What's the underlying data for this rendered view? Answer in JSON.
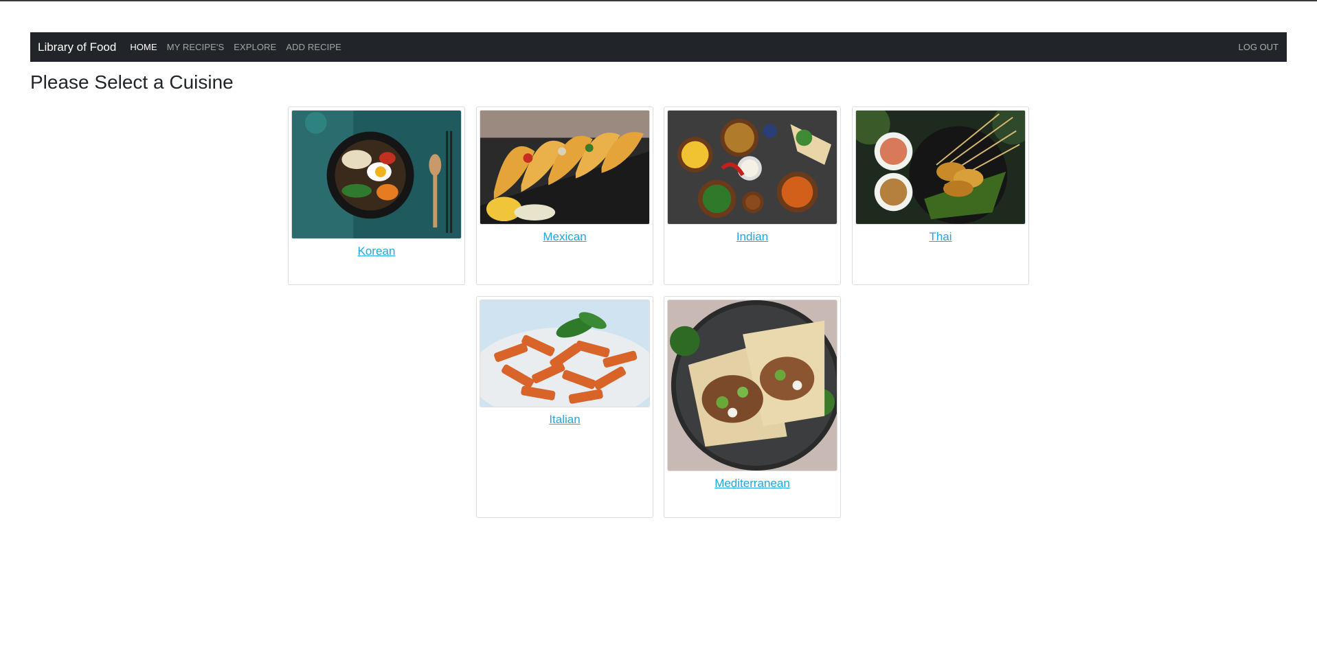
{
  "navbar": {
    "brand": "Library of Food",
    "links": [
      "HOME",
      "MY RECIPE'S",
      "EXPLORE",
      "ADD RECIPE"
    ],
    "logout": "LOG OUT"
  },
  "page": {
    "title": "Please Select a Cuisine"
  },
  "cuisines": [
    {
      "label": "Korean"
    },
    {
      "label": "Mexican"
    },
    {
      "label": "Indian"
    },
    {
      "label": "Thai"
    },
    {
      "label": "Italian"
    },
    {
      "label": "Mediterranean"
    }
  ]
}
